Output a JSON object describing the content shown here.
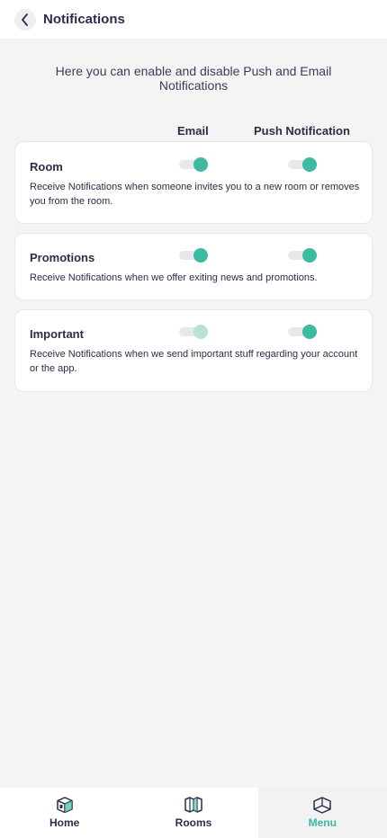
{
  "header": {
    "title": "Notifications"
  },
  "intro": "Here you can enable and disable Push and Email Notifications",
  "columns": {
    "email": "Email",
    "push": "Push Notification"
  },
  "settings": [
    {
      "title": "Room",
      "description": "Receive Notifications when someone invites you to a new room or removes you from the room.",
      "email": true,
      "push": true
    },
    {
      "title": "Promotions",
      "description": "Receive Notifications when we offer exiting news and promotions.",
      "email": true,
      "push": true
    },
    {
      "title": "Important",
      "description": "Receive Notifications when we send important stuff regarding your account or the app.",
      "email": true,
      "email_disabled": true,
      "push": true
    }
  ],
  "tabbar": {
    "items": [
      {
        "label": "Home",
        "icon": "home-cube-icon",
        "active": false
      },
      {
        "label": "Rooms",
        "icon": "rooms-map-icon",
        "active": false
      },
      {
        "label": "Menu",
        "icon": "menu-box-icon",
        "active": true
      }
    ]
  },
  "colors": {
    "accent": "#3dbaa2",
    "accent_faded": "#b7e2d9",
    "text": "#2b2d4a",
    "background": "#f4f4f4"
  }
}
